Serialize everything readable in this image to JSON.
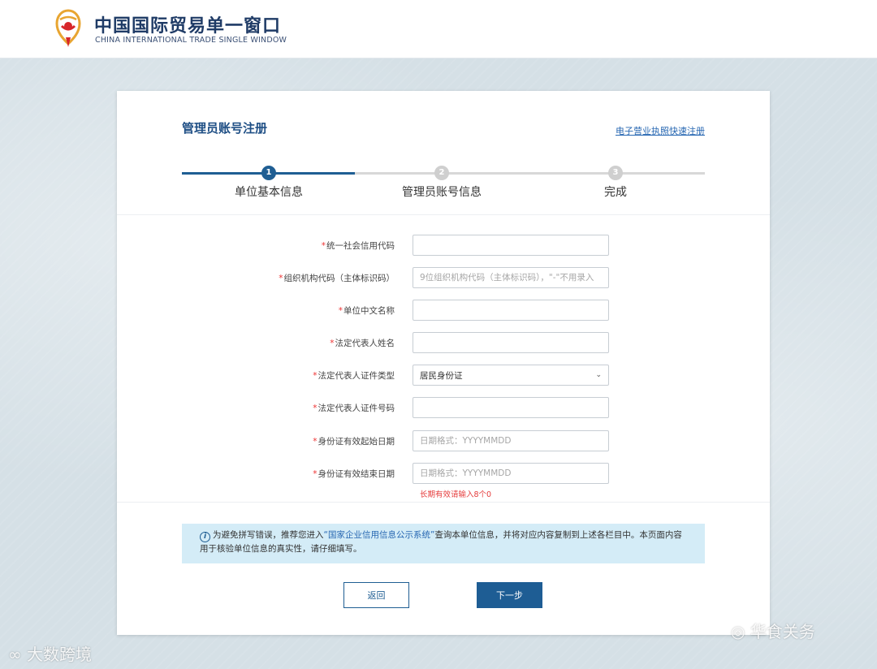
{
  "header": {
    "title": "中国国际贸易单一窗口",
    "subtitle": "CHINA INTERNATIONAL TRADE SINGLE WINDOW"
  },
  "page": {
    "title": "管理员账号注册",
    "quick_link": "电子营业执照快速注册"
  },
  "steps": [
    {
      "number": "1",
      "label": "单位基本信息",
      "state": "active"
    },
    {
      "number": "2",
      "label": "管理员账号信息",
      "state": "inactive"
    },
    {
      "number": "3",
      "label": "完成",
      "state": "inactive"
    }
  ],
  "form": {
    "required_mark": "*",
    "fields": [
      {
        "label": "统一社会信用代码",
        "value": "",
        "placeholder": ""
      },
      {
        "label": "组织机构代码（主体标识码）",
        "value": "",
        "placeholder": "9位组织机构代码（主体标识码），\"-\"不用录入"
      },
      {
        "label": "单位中文名称",
        "value": "",
        "placeholder": ""
      },
      {
        "label": "法定代表人姓名",
        "value": "",
        "placeholder": ""
      },
      {
        "label": "法定代表人证件类型",
        "value": "居民身份证",
        "placeholder": ""
      },
      {
        "label": "法定代表人证件号码",
        "value": "",
        "placeholder": ""
      },
      {
        "label": "身份证有效起始日期",
        "value": "",
        "placeholder": "日期格式：YYYYMMDD"
      },
      {
        "label": "身份证有效结束日期",
        "value": "",
        "placeholder": "日期格式：YYYYMMDD"
      }
    ],
    "hint": "长期有效请输入8个0"
  },
  "notice": {
    "icon": "i",
    "text_before": "为避免拼写错误，推荐您进入",
    "link": "“国家企业信用信息公示系统”",
    "text_after": "查询本单位信息，并将对应内容复制到上述各栏目中。本页面内容用于核验单位信息的真实性，请仔细填写。"
  },
  "buttons": {
    "back": "返回",
    "next": "下一步"
  },
  "watermarks": {
    "left": "大数跨境",
    "right": "华食关务"
  },
  "colors": {
    "primary": "#1f5e93",
    "required": "#e33333",
    "notice_bg": "#d4ecf7"
  }
}
